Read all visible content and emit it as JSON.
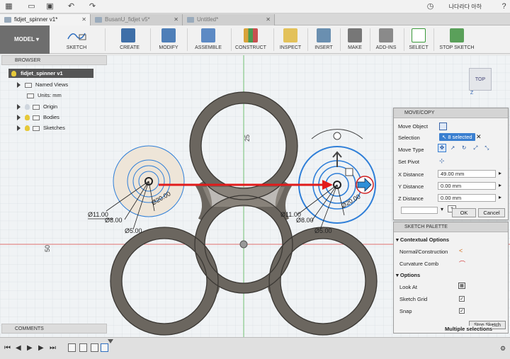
{
  "document_tabs": [
    {
      "label": "fidjet_spinner v1*",
      "active": true
    },
    {
      "label": "BusanU_fidjet v5*",
      "active": false
    },
    {
      "label": "Untitled*",
      "active": false
    }
  ],
  "user_name": "나다라다 아하",
  "toolbar": {
    "workspace": "MODEL",
    "tools": [
      {
        "label": "SKETCH",
        "icon": "sketch-icon"
      },
      {
        "label": "CREATE",
        "icon": "create-icon"
      },
      {
        "label": "MODIFY",
        "icon": "modify-icon"
      },
      {
        "label": "ASSEMBLE",
        "icon": "assemble-icon"
      },
      {
        "label": "CONSTRUCT",
        "icon": "construct-icon"
      },
      {
        "label": "INSPECT",
        "icon": "inspect-icon"
      },
      {
        "label": "INSERT",
        "icon": "insert-icon"
      },
      {
        "label": "MAKE",
        "icon": "make-icon"
      },
      {
        "label": "ADD-INS",
        "icon": "add-ins-icon"
      },
      {
        "label": "SELECT",
        "icon": "select-icon"
      },
      {
        "label": "STOP SKETCH",
        "icon": "stop-sketch-icon"
      }
    ]
  },
  "browser": {
    "title": "BROWSER",
    "root": "fidjet_spinner v1",
    "items": [
      "Named Views",
      "Units: mm",
      "Origin",
      "Bodies",
      "Sketches"
    ]
  },
  "viewcube": {
    "face": "TOP",
    "axis": "Z"
  },
  "move_copy": {
    "title": "MOVE/COPY",
    "move_object_label": "Move Object",
    "selection_label": "Selection",
    "selection_value": "8 selected",
    "move_type_label": "Move Type",
    "set_pivot_label": "Set Pivot",
    "x_label": "X Distance",
    "x_value": "49.00 mm",
    "y_label": "Y Distance",
    "y_value": "0.00 mm",
    "z_label": "Z Distance",
    "z_value": "0.00 mm",
    "ok": "OK",
    "cancel": "Cancel"
  },
  "sketch_palette": {
    "title": "SKETCH PALETTE",
    "contextual_title": "Contextual Options",
    "normal_construction": "Normal/Construction",
    "curvature_comb": "Curvature Comb",
    "options_title": "Options",
    "look_at": "Look At",
    "sketch_grid": "Sketch Grid",
    "snap": "Snap",
    "stop_sketch": "Stop Sketch",
    "multiple_selections": "Multiple selections"
  },
  "comments_label": "COMMENTS",
  "dimensions": {
    "left_d1": "Ø11.00",
    "left_d2": "Ø8.00",
    "left_d3": "Ø5.00",
    "left_d4": "Ø20.00",
    "right_d1": "Ø11.00",
    "right_d2": "Ø8.00",
    "right_d3": "Ø5.00",
    "right_d4": "Ø20.00",
    "vertical_25": "25",
    "horizontal_50": "50"
  },
  "colors": {
    "selection_blue": "#2f7fd8",
    "arrow_red": "#e21b1b",
    "ring_gray": "#6b665f",
    "axis_red": "#d55",
    "axis_green": "#6b6"
  }
}
